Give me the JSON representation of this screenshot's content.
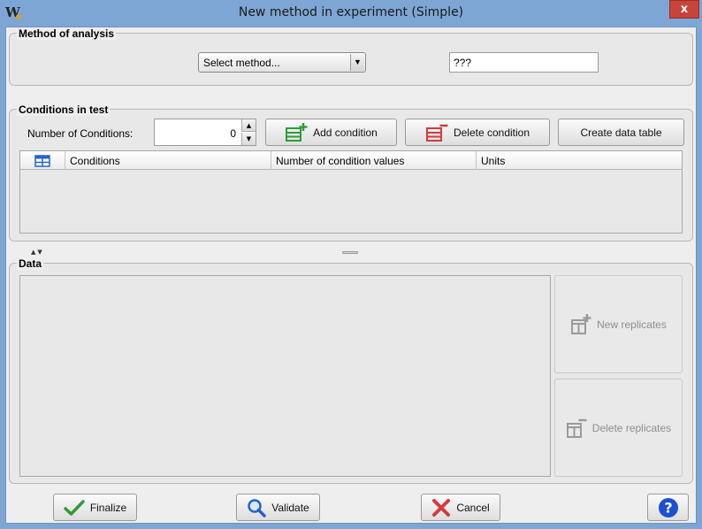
{
  "window": {
    "title": "New method in experiment (Simple)",
    "app_icon_letter": "W",
    "close_glyph": "x"
  },
  "method_group": {
    "title": "Method of analysis",
    "select_value": "Select method...",
    "name_value": "???"
  },
  "conditions_group": {
    "title": "Conditions in test",
    "count_label": "Number of Conditions:",
    "count_value": "0",
    "add_label": "Add condition",
    "delete_label": "Delete condition",
    "create_label": "Create data table",
    "table_columns": [
      "Conditions",
      "Number of condition values",
      "Units"
    ]
  },
  "data_group": {
    "title": "Data",
    "new_replicates_label": "New replicates",
    "delete_replicates_label": "Delete replicates"
  },
  "footer": {
    "finalize_label": "Finalize",
    "validate_label": "Validate",
    "cancel_label": "Cancel",
    "help_glyph": "?"
  },
  "colors": {
    "add_icon": "#2e9d3a",
    "delete_icon": "#d13c3c",
    "finalize_check": "#2e9d3a",
    "validate_icon": "#2563c9",
    "cancel_icon": "#d13c3c",
    "help_icon": "#1e4fd1"
  }
}
